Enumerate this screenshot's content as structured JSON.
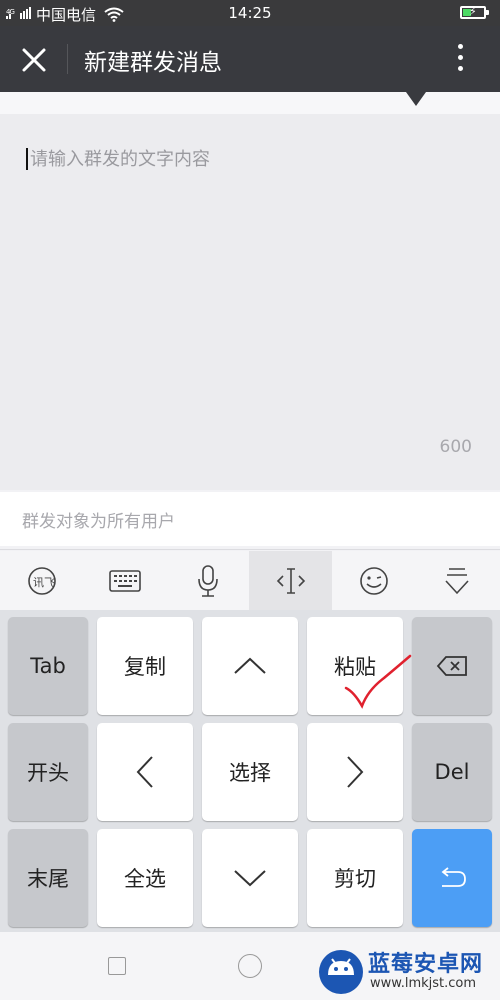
{
  "status_bar": {
    "carrier": "中国电信",
    "signal_label": "4G",
    "time": "14:25"
  },
  "header": {
    "title": "新建群发消息",
    "close_icon": "close-icon",
    "more_icon": "more-vertical-icon"
  },
  "compose": {
    "placeholder": "请输入群发的文字内容",
    "char_limit": "600"
  },
  "recipients": {
    "text": "群发对象为所有用户"
  },
  "ime_toolbar": {
    "items": [
      "logo-icon",
      "keyboard-icon",
      "mic-icon",
      "cursor-edit-icon",
      "emoji-icon",
      "collapse-keyboard-icon"
    ],
    "active_index": 3
  },
  "keyboard": {
    "row1": [
      "Tab",
      "复制",
      "↑",
      "粘贴",
      "⌫"
    ],
    "row2": [
      "开头",
      "←",
      "选择",
      "→",
      "Del"
    ],
    "row3": [
      "末尾",
      "全选",
      "↓",
      "剪切",
      "↵"
    ],
    "labels": {
      "tab": "Tab",
      "copy": "复制",
      "paste": "粘贴",
      "start": "开头",
      "select": "选择",
      "del": "Del",
      "end": "末尾",
      "select_all": "全选",
      "cut": "剪切"
    }
  },
  "watermark": {
    "title": "蓝莓安卓网",
    "url": "www.lmkjst.com"
  },
  "colors": {
    "header_bg": "#393a3f",
    "enter_key": "#4c9ef5",
    "annotation_stroke": "#e0212e"
  }
}
